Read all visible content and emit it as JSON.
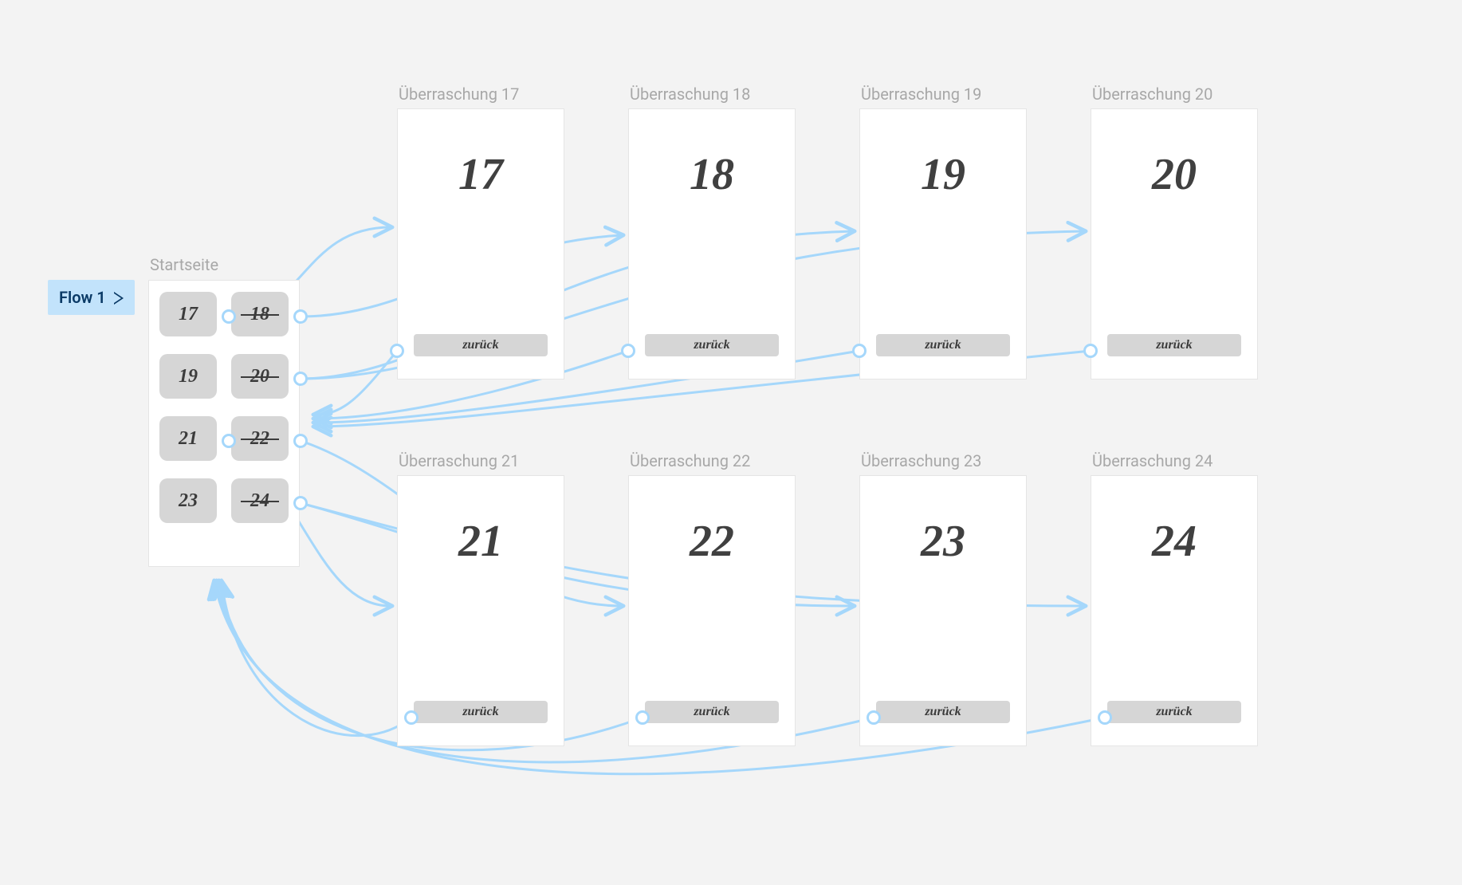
{
  "flow_label": "Flow 1",
  "start_label": "Startseite",
  "start_cells": [
    {
      "num": "17",
      "strike": false
    },
    {
      "num": "18",
      "strike": true
    },
    {
      "num": "19",
      "strike": false
    },
    {
      "num": "20",
      "strike": true
    },
    {
      "num": "21",
      "strike": false
    },
    {
      "num": "22",
      "strike": true
    },
    {
      "num": "23",
      "strike": false
    },
    {
      "num": "24",
      "strike": true
    }
  ],
  "back_label": "zurück",
  "details_row1": [
    {
      "title": "Überraschung 17",
      "num": "17"
    },
    {
      "title": "Überraschung 18",
      "num": "18"
    },
    {
      "title": "Überraschung 19",
      "num": "19"
    },
    {
      "title": "Überraschung 20",
      "num": "20"
    }
  ],
  "details_row2": [
    {
      "title": "Überraschung 21",
      "num": "21"
    },
    {
      "title": "Überraschung 22",
      "num": "22"
    },
    {
      "title": "Überraschung 23",
      "num": "23"
    },
    {
      "title": "Überraschung 24",
      "num": "24"
    }
  ],
  "colors": {
    "connector": "#a5d7fb",
    "badge_bg": "#c2e3fb"
  }
}
